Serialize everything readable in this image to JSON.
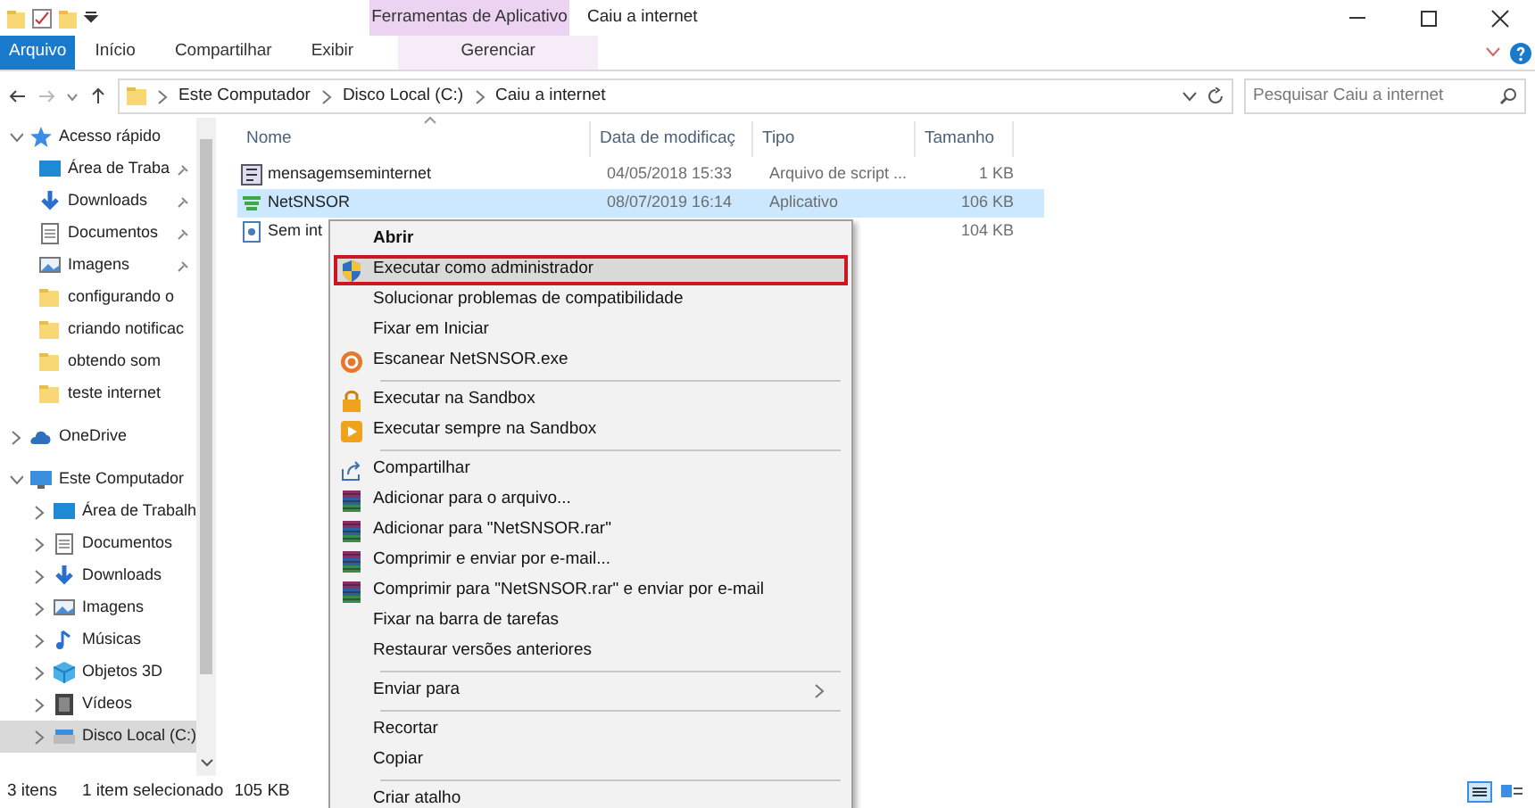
{
  "window": {
    "title": "Caiu a internet",
    "context_group": "Ferramentas de Aplicativo"
  },
  "ribbon_tabs": [
    {
      "label": "Arquivo",
      "kind": "file"
    },
    {
      "label": "Início",
      "kind": "tab"
    },
    {
      "label": "Compartilhar",
      "kind": "tab"
    },
    {
      "label": "Exibir",
      "kind": "tab"
    },
    {
      "label": "Gerenciar",
      "kind": "context"
    }
  ],
  "address": {
    "breadcrumbs": [
      "Este Computador",
      "Disco Local (C:)",
      "Caiu a internet"
    ]
  },
  "search": {
    "placeholder": "Pesquisar Caiu a internet"
  },
  "sidebar": {
    "items": [
      {
        "label": "Acesso rápido",
        "kind": "star",
        "expanded": true,
        "children": [
          {
            "label": "Área de Traba",
            "kind": "desktop",
            "pinned": true
          },
          {
            "label": "Downloads",
            "kind": "download",
            "pinned": true
          },
          {
            "label": "Documentos",
            "kind": "document",
            "pinned": true
          },
          {
            "label": "Imagens",
            "kind": "image",
            "pinned": true
          },
          {
            "label": "configurando o",
            "kind": "folder",
            "pinned": false
          },
          {
            "label": "criando notificac",
            "kind": "folder",
            "pinned": false
          },
          {
            "label": "obtendo som",
            "kind": "folder",
            "pinned": false
          },
          {
            "label": "teste internet",
            "kind": "folder",
            "pinned": false
          }
        ]
      },
      {
        "label": "OneDrive",
        "kind": "cloud",
        "expanded": false
      },
      {
        "label": "Este Computador",
        "kind": "computer",
        "expanded": true,
        "children": [
          {
            "label": "Área de Trabalh",
            "kind": "desktop",
            "expanded": false
          },
          {
            "label": "Documentos",
            "kind": "document",
            "expanded": false
          },
          {
            "label": "Downloads",
            "kind": "download",
            "expanded": false
          },
          {
            "label": "Imagens",
            "kind": "image",
            "expanded": false
          },
          {
            "label": "Músicas",
            "kind": "music",
            "expanded": false
          },
          {
            "label": "Objetos 3D",
            "kind": "cube",
            "expanded": false
          },
          {
            "label": "Vídeos",
            "kind": "video",
            "expanded": false
          },
          {
            "label": "Disco Local (C:)",
            "kind": "drive",
            "expanded": false,
            "selected": true
          }
        ]
      }
    ]
  },
  "table": {
    "columns": [
      "Nome",
      "Data de modificaç",
      "Tipo",
      "Tamanho"
    ],
    "rows": [
      {
        "name": "mensagemseminternet",
        "date": "04/05/2018 15:33",
        "type": "Arquivo de script ...",
        "size": "1 KB",
        "kind": "script",
        "selected": false
      },
      {
        "name": "NetSNSOR",
        "date": "08/07/2019 16:14",
        "type": "Aplicativo",
        "size": "106 KB",
        "kind": "app",
        "selected": true
      },
      {
        "name": "Sem int",
        "size": "104 KB",
        "kind": "doc",
        "selected": false
      }
    ]
  },
  "context_menu": {
    "items": [
      {
        "label": "Abrir",
        "kind": "default",
        "selected": false
      },
      {
        "label": "Executar como administrador",
        "kind": "shield",
        "selected": true
      },
      {
        "label": "Solucionar problemas de compatibilidade",
        "kind": "plain",
        "selected": false
      },
      {
        "label": "Fixar em Iniciar",
        "kind": "plain",
        "selected": false
      },
      {
        "label": "Escanear NetSNSOR.exe",
        "kind": "scan",
        "selected": false
      },
      {
        "kind": "separator"
      },
      {
        "label": "Executar na Sandbox",
        "kind": "sandbox",
        "selected": false
      },
      {
        "label": "Executar sempre na Sandbox",
        "kind": "sandbox-always",
        "selected": false
      },
      {
        "kind": "separator"
      },
      {
        "label": "Compartilhar",
        "kind": "share",
        "selected": false
      },
      {
        "label": "Adicionar para o arquivo...",
        "kind": "archive",
        "selected": false
      },
      {
        "label": "Adicionar para \"NetSNSOR.rar\"",
        "kind": "archive",
        "selected": false
      },
      {
        "label": "Comprimir e enviar por e-mail...",
        "kind": "archive",
        "selected": false
      },
      {
        "label": "Comprimir para \"NetSNSOR.rar\" e enviar por e-mail",
        "kind": "archive",
        "selected": false
      },
      {
        "label": "Fixar na barra de tarefas",
        "kind": "plain",
        "selected": false
      },
      {
        "label": "Restaurar versões anteriores",
        "kind": "plain",
        "selected": false
      },
      {
        "kind": "separator"
      },
      {
        "label": "Enviar para",
        "kind": "submenu",
        "selected": false
      },
      {
        "kind": "separator"
      },
      {
        "label": "Recortar",
        "kind": "plain",
        "selected": false
      },
      {
        "label": "Copiar",
        "kind": "plain",
        "selected": false
      },
      {
        "kind": "separator"
      },
      {
        "label": "Criar atalho",
        "kind": "plain",
        "selected": false
      }
    ]
  },
  "status_bar": {
    "items": [
      "3 itens",
      "1 item selecionado",
      "105 KB"
    ]
  }
}
